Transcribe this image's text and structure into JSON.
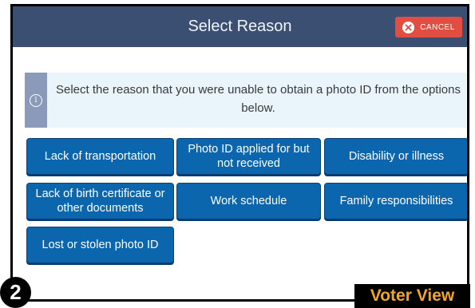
{
  "header": {
    "title": "Select Reason",
    "cancel_label": "CANCEL",
    "cancel_icon": "close-circle-icon",
    "background": "#3b4f72",
    "cancel_color": "#e24d42"
  },
  "info": {
    "icon": "info-icon",
    "glyph": "i",
    "text": "Select the reason that you were unable to obtain a photo ID from the options below."
  },
  "options": [
    "Lack of transportation",
    "Photo ID applied for but not received",
    "Disability or illness",
    "Lack of birth certificate or other documents",
    "Work schedule",
    "Family responsibilities",
    "Lost or stolen photo ID"
  ],
  "overlay": {
    "step_number": "2",
    "label": "Voter View",
    "label_color": "#f5a524"
  },
  "colors": {
    "button": "#0b66ad",
    "info_background": "#eaf4fb"
  }
}
